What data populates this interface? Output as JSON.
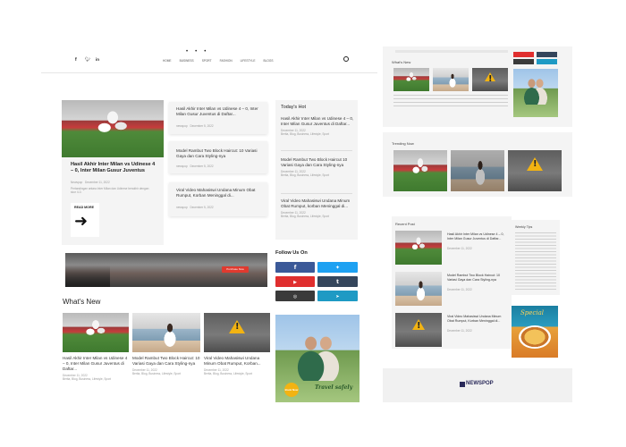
{
  "nav": {
    "items": [
      "HOME",
      "BUSINESS",
      "SPORT",
      "FASHION",
      "LIFESTYLE",
      "BLOGS"
    ]
  },
  "featured": {
    "title": "Hasil Akhir Inter Milan vs Udinese 4 – 0, Inter Milan Gusur Juventus",
    "author": "Newspop",
    "date": "December 11, 2022",
    "excerpt": "Pertandingan antara Inter Milan dan Udinese berakhir dengan skor 4-0.",
    "read_more": "READ MORE"
  },
  "mid_list": [
    {
      "title": "Hasil Akhir Inter Milan vs Udinese 4 – 0, Inter Milan Gusur Juventus di Daftar...",
      "author": "newspop",
      "date": "December 5, 2022"
    },
    {
      "title": "Model Rambut Two Block Haircut: 10 Variasi Gaya dan Cara Styling-nya",
      "author": "newspop",
      "date": "December 5, 2022"
    },
    {
      "title": "Viral Video Mahasiswi Undana Minum Obat Rumput, Korban Meninggal di...",
      "author": "newspop",
      "date": "December 5, 2022"
    }
  ],
  "todays_hot": {
    "heading": "Today's Hot",
    "items": [
      {
        "title": "Hasil Akhir Inter Milan vs Udinese 4 – 0, Inter Milan Gusur Juventus di Daftar...",
        "meta": "December 11, 2022",
        "tags": "Berita, Blog, Business, Lifestyle, Sport"
      },
      {
        "title": "Model Rambut Two Block Haircut 10 Variasi Gaya dan Cara Styling-nya",
        "meta": "December 11, 2022",
        "tags": "Berita, Blog, Business, Lifestyle, Sport"
      },
      {
        "title": "Viral Video Mahasiswi Undana Minum Obat Rumput, korban Meninggal di...",
        "meta": "December 11, 2022",
        "tags": "Berita, Blog, Business, Lifestyle, Sport"
      }
    ]
  },
  "banner": {
    "button": "Purchase Now"
  },
  "follow": {
    "heading": "Follow Us On",
    "colors": {
      "facebook": "#3b5998",
      "twitter": "#1da1f2",
      "youtube": "#e02f2f",
      "tumblr": "#35465c",
      "instagram": "#3a3a3a",
      "telegram": "#1e9ac4"
    }
  },
  "whats_new": {
    "heading": "What's New",
    "items": [
      {
        "title": "Hasil Akhir Inter Milan vs Udinese 4 – 0, Inter Milan Gusur Juventus di Daftar...",
        "meta": "December 11, 2022",
        "tags": "Berita, Blog, Business, Lifestyle, Sport"
      },
      {
        "title": "Model Rambut Two Block Haircut: 10 Variasi Gaya dan Cara Styling-nya",
        "meta": "December 11, 2022",
        "tags": "Berita, Blog, Business, Lifestyle, Sport"
      },
      {
        "title": "Viral Video Mahasiswi Undana Minum Obat Rumput, Korban...",
        "meta": "December 11, 2022",
        "tags": "Berita, Blog, Business, Lifestyle, Sport"
      }
    ]
  },
  "travel_ad": {
    "title": "Travel safely",
    "badge": "Book Now"
  },
  "right_whats_new": {
    "heading": "What's New"
  },
  "trending": {
    "heading": "Trending Now"
  },
  "recent": {
    "heading": "Recent Post",
    "items": [
      {
        "title": "Hasil Akhir Inter Milan vs Udinese 4 – 0, Inter Milan Gusur Juventus di Daftar...",
        "meta": "December 11, 2022"
      },
      {
        "title": "Model Rambut Two Block Haircut: 10 Variasi Gaya dan Cara Styling-nya",
        "meta": "December 11, 2022"
      },
      {
        "title": "Viral Video Mahasiswi Undana Minum Obat Rumput, Korban Meninggal di...",
        "meta": "December 11, 2022"
      }
    ]
  },
  "weekly": {
    "heading": "Weekly Tips"
  },
  "food_ad": {
    "title": "Special"
  },
  "footer": {
    "logo": "NEWSPOP"
  }
}
